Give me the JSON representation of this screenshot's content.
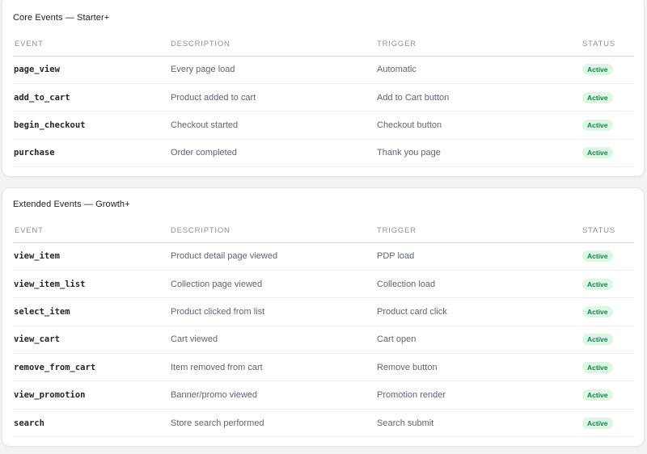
{
  "core": {
    "title": "Core Events — Starter+",
    "headers": {
      "event": "EVENT",
      "description": "DESCRIPTION",
      "trigger": "TRIGGER",
      "status": "STATUS"
    },
    "rows": [
      {
        "event": "page_view",
        "description": "Every page load",
        "trigger": "Automatic",
        "status": "Active"
      },
      {
        "event": "add_to_cart",
        "description": "Product added to cart",
        "trigger": "Add to Cart button",
        "status": "Active"
      },
      {
        "event": "begin_checkout",
        "description": "Checkout started",
        "trigger": "Checkout button",
        "status": "Active"
      },
      {
        "event": "purchase",
        "description": "Order completed",
        "trigger": "Thank you page",
        "status": "Active"
      }
    ]
  },
  "extended": {
    "title": "Extended Events — Growth+",
    "headers": {
      "event": "EVENT",
      "description": "DESCRIPTION",
      "trigger": "TRIGGER",
      "status": "STATUS"
    },
    "rows": [
      {
        "event": "view_item",
        "description": "Product detail page viewed",
        "trigger": "PDP load",
        "status": "Active"
      },
      {
        "event": "view_item_list",
        "description": "Collection page viewed",
        "trigger": "Collection load",
        "status": "Active"
      },
      {
        "event": "select_item",
        "description": "Product clicked from list",
        "trigger": "Product card click",
        "status": "Active"
      },
      {
        "event": "view_cart",
        "description": "Cart viewed",
        "trigger": "Cart open",
        "status": "Active"
      },
      {
        "event": "remove_from_cart",
        "description": "Item removed from cart",
        "trigger": "Remove button",
        "status": "Active"
      },
      {
        "event": "view_promotion",
        "description": "Banner/promo viewed",
        "trigger": "Promotion render",
        "status": "Active"
      },
      {
        "event": "search",
        "description": "Store search performed",
        "trigger": "Search submit",
        "status": "Active"
      }
    ]
  },
  "colors": {
    "badge_bg": "#dcf7e6",
    "badge_text": "#17804a"
  }
}
